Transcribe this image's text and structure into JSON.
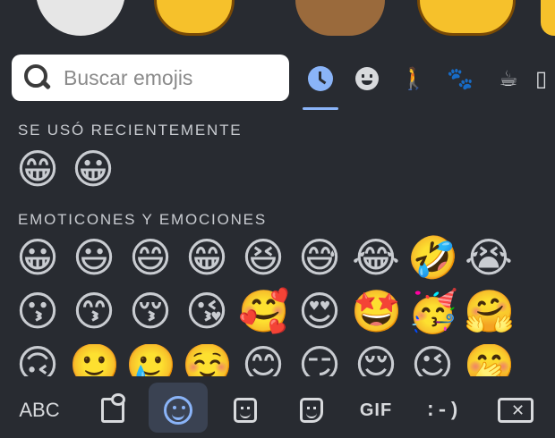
{
  "search": {
    "placeholder": "Buscar emojis"
  },
  "category_tabs": [
    {
      "name": "recent",
      "icon": "clock-icon",
      "selected": true
    },
    {
      "name": "smileys",
      "icon": "smiley-icon"
    },
    {
      "name": "people",
      "icon": "person-icon"
    },
    {
      "name": "animals",
      "icon": "paw-icon"
    },
    {
      "name": "food",
      "icon": "cup-icon"
    },
    {
      "name": "more",
      "icon": "building-icon"
    }
  ],
  "sections": {
    "recent_title": "SE USÓ RECIENTEMENTE",
    "emotions_title": "EMOTICONES Y EMOCIONES"
  },
  "recent_emojis": [
    "😁",
    "😀"
  ],
  "emotion_rows": [
    [
      "😀",
      "😃",
      "😄",
      "😁",
      "😆",
      "😅",
      "😂",
      "🤣",
      "😭"
    ],
    [
      "😗",
      "😙",
      "😚",
      "😘",
      "🥰",
      "😍",
      "🤩",
      "🥳",
      "🤗"
    ],
    [
      "🙃",
      "🙂",
      "🥲",
      "☺️",
      "😊",
      "😏",
      "😌",
      "😉",
      "🤭"
    ]
  ],
  "bottom_bar": {
    "abc_label": "ABC",
    "gif_label": "GIF",
    "emoticon_label": ":-)"
  },
  "colors": {
    "background": "#282b31",
    "accent": "#8ab4f8"
  }
}
